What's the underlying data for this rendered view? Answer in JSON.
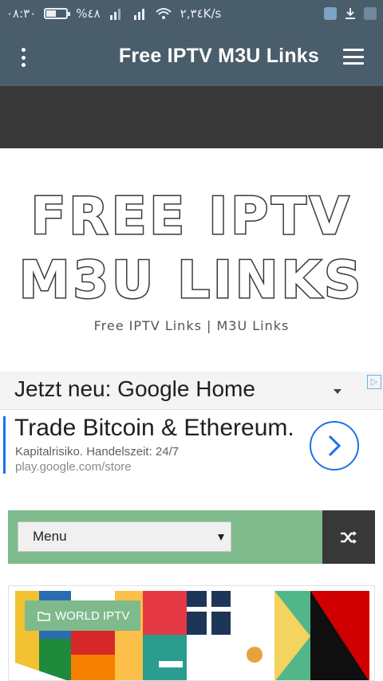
{
  "status_bar": {
    "time": "٠٨:٣٠",
    "battery_percent": "%٤٨",
    "speed": "٢,٣٤K/s",
    "battery_level": 0.48
  },
  "app_bar": {
    "title": "Free IPTV M3U Links"
  },
  "site_header": {
    "title_line1": "FREE IPTV",
    "title_line2": "M3U LINKS",
    "tagline": "Free IPTV Links | M3U Links"
  },
  "ad": {
    "headline": "Jetzt neu: Google Home",
    "title": "Trade Bitcoin & Ethereum.",
    "description": "Kapitalrisiko. Handelszeit: 24/7",
    "url": "play.google.com/store",
    "badge": "▷"
  },
  "menu_bar": {
    "select_label": "Menu"
  },
  "post": {
    "category": "WORLD IPTV"
  },
  "colors": {
    "bar": "#4a5d6b",
    "accent_green": "#7fba8c",
    "dark": "#383838"
  }
}
